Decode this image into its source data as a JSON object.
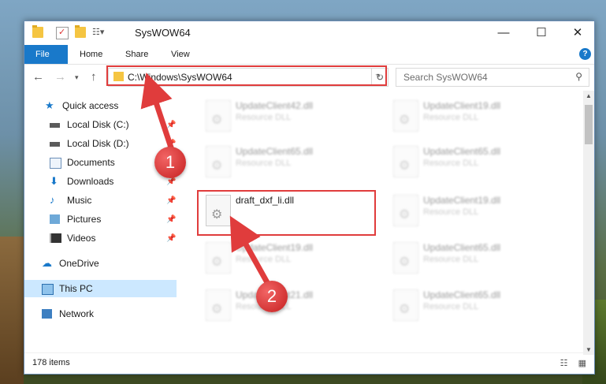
{
  "window": {
    "title": "SysWOW64",
    "minimize_glyph": "—",
    "maximize_glyph": "☐",
    "close_glyph": "✕"
  },
  "ribbon": {
    "tabs": [
      "File",
      "Home",
      "Share",
      "View"
    ],
    "help": "?"
  },
  "address": {
    "path": "C:\\Windows\\SysWOW64",
    "search_placeholder": "Search SysWOW64"
  },
  "sidebar": {
    "items": [
      {
        "label": "Quick access",
        "icon": "star-icon"
      },
      {
        "label": "Local Disk (C:)",
        "icon": "drive-icon"
      },
      {
        "label": "Local Disk (D:)",
        "icon": "drive-icon"
      },
      {
        "label": "Documents",
        "icon": "documents-icon"
      },
      {
        "label": "Downloads",
        "icon": "download-icon"
      },
      {
        "label": "Music",
        "icon": "music-icon"
      },
      {
        "label": "Pictures",
        "icon": "pictures-icon"
      },
      {
        "label": "Videos",
        "icon": "videos-icon"
      },
      {
        "label": "OneDrive",
        "icon": "cloud-icon"
      },
      {
        "label": "This PC",
        "icon": "computer-icon"
      },
      {
        "label": "Network",
        "icon": "network-icon"
      }
    ]
  },
  "files": [
    {
      "name": "UpdateClient42.dll",
      "type": "Resource DLL"
    },
    {
      "name": "UpdateClient19.dll",
      "type": "Resource DLL"
    },
    {
      "name": "UpdateClient65.dll",
      "type": "Resource DLL"
    },
    {
      "name": "UpdateClient65.dll",
      "type": "Resource DLL"
    },
    {
      "name": "draft_dxf_li.dll",
      "type": ""
    },
    {
      "name": "UpdateClient19.dll",
      "type": "Resource DLL"
    },
    {
      "name": "UpdateClient19.dll",
      "type": "Resource DLL"
    },
    {
      "name": "UpdateClient65.dll",
      "type": "Resource DLL"
    },
    {
      "name": "UpdateClient21.dll",
      "type": "Resource DLL"
    },
    {
      "name": "UpdateClient65.dll",
      "type": "Resource DLL"
    }
  ],
  "status": {
    "items_count": "178 items"
  },
  "annotations": {
    "step1": "1",
    "step2": "2",
    "color": "#e03c3c"
  }
}
